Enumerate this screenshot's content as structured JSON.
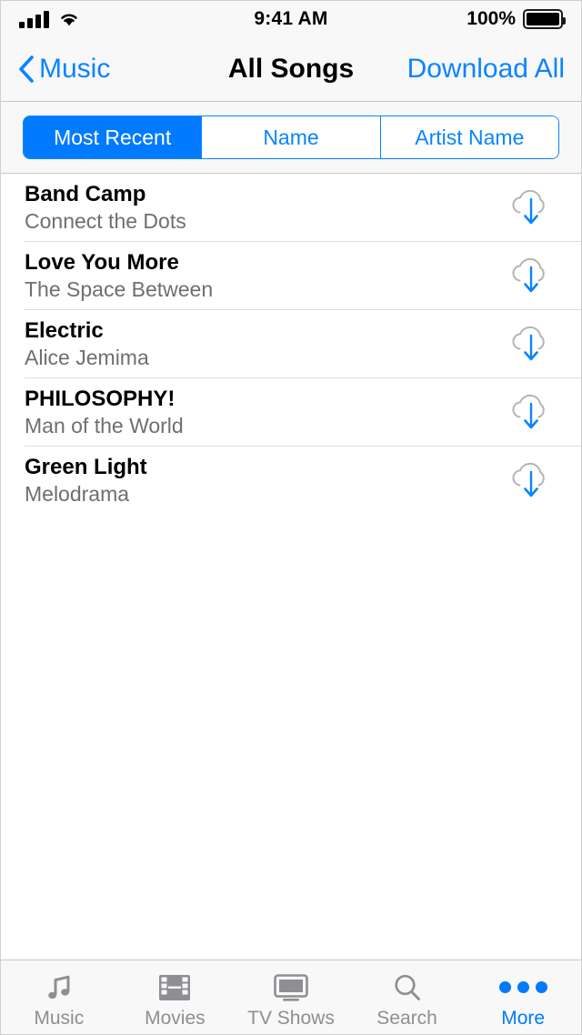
{
  "status_bar": {
    "signal_icon": "cellular-signal-icon",
    "signal_bars": 4,
    "wifi_icon": "wifi-icon",
    "time": "9:41 AM",
    "battery_percent": "100%",
    "battery_icon": "battery-full-icon"
  },
  "nav_bar": {
    "back_icon": "chevron-left-icon",
    "back_label": "Music",
    "title": "All Songs",
    "action_label": "Download All"
  },
  "segmented_control": {
    "selected_index": 0,
    "options": [
      {
        "label": "Most Recent"
      },
      {
        "label": "Name"
      },
      {
        "label": "Artist Name"
      }
    ]
  },
  "songs": [
    {
      "title": "Band Camp",
      "subtitle": "Connect the Dots",
      "action_icon": "cloud-download-icon"
    },
    {
      "title": "Love You More",
      "subtitle": "The Space Between",
      "action_icon": "cloud-download-icon"
    },
    {
      "title": "Electric",
      "subtitle": "Alice Jemima",
      "action_icon": "cloud-download-icon"
    },
    {
      "title": "PHILOSOPHY!",
      "subtitle": "Man of the World",
      "action_icon": "cloud-download-icon"
    },
    {
      "title": "Green Light",
      "subtitle": "Melodrama",
      "action_icon": "cloud-download-icon"
    }
  ],
  "tab_bar": {
    "active_index": 4,
    "tabs": [
      {
        "label": "Music",
        "icon": "music-note-icon"
      },
      {
        "label": "Movies",
        "icon": "film-strip-icon"
      },
      {
        "label": "TV Shows",
        "icon": "television-icon"
      },
      {
        "label": "Search",
        "icon": "magnifier-icon"
      },
      {
        "label": "More",
        "icon": "ellipsis-icon"
      }
    ]
  },
  "colors": {
    "accent_blue": "#007AFF",
    "link_blue": "#0A84FF",
    "bar_background": "#F8F8F8",
    "secondary_text": "#6E6E73",
    "tab_inactive": "#8E8E93",
    "separator": "#DCDCDC",
    "cloud_outline": "#B4B4B4"
  }
}
